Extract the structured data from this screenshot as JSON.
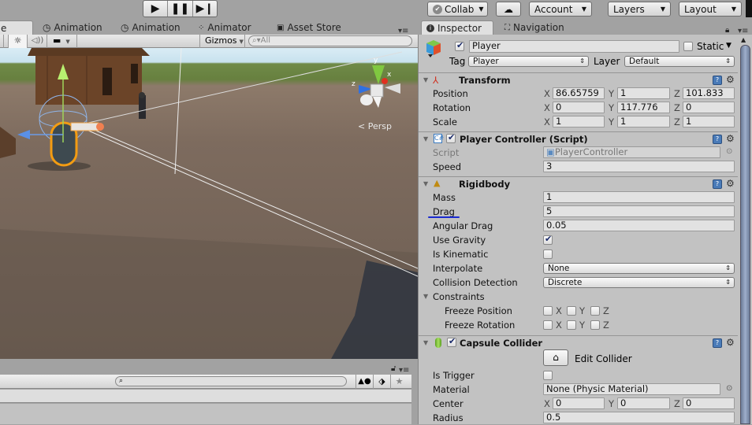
{
  "toolbar": {
    "play_icon": "play-icon",
    "pause_icon": "pause-icon",
    "step_icon": "step-icon",
    "collab": "Collab",
    "cloud_icon": "cloud-icon",
    "account": "Account",
    "layers": "Layers",
    "layout": "Layout"
  },
  "tabs": [
    {
      "label": "e",
      "icon": "scene-icon"
    },
    {
      "label": "Animation",
      "icon": "clock-icon"
    },
    {
      "label": "Animation",
      "icon": "clock-icon"
    },
    {
      "label": "Animator",
      "icon": "animator-icon"
    },
    {
      "label": "Asset Store",
      "icon": "store-icon"
    }
  ],
  "scene_toolbar": {
    "gizmos": "Gizmos",
    "search_placeholder": "All"
  },
  "scene": {
    "persp_label": "< Persp",
    "axis_y": "y",
    "axis_x": "x",
    "axis_z": "z"
  },
  "inspector": {
    "tabs": [
      {
        "label": "Inspector"
      },
      {
        "label": "Navigation"
      }
    ],
    "object": {
      "name": "Player",
      "active": true,
      "static_label": "Static",
      "static": false,
      "tag_label": "Tag",
      "tag": "Player",
      "layer_label": "Layer",
      "layer": "Default"
    },
    "transform": {
      "title": "Transform",
      "rows": [
        {
          "label": "Position",
          "x": "86.65759",
          "y": "1",
          "z": "101.833"
        },
        {
          "label": "Rotation",
          "x": "0",
          "y": "117.776",
          "z": "0"
        },
        {
          "label": "Scale",
          "x": "1",
          "y": "1",
          "z": "1"
        }
      ]
    },
    "player_controller": {
      "title": "Player Controller (Script)",
      "enabled": true,
      "script_label": "Script",
      "script_value": "PlayerController",
      "speed_label": "Speed",
      "speed_value": "3"
    },
    "rigidbody": {
      "title": "Rigidbody",
      "mass_label": "Mass",
      "mass": "1",
      "drag_label": "Drag",
      "drag": "5",
      "angular_drag_label": "Angular Drag",
      "angular_drag": "0.05",
      "use_gravity_label": "Use Gravity",
      "use_gravity": true,
      "is_kinematic_label": "Is Kinematic",
      "is_kinematic": false,
      "interpolate_label": "Interpolate",
      "interpolate": "None",
      "collision_label": "Collision Detection",
      "collision": "Discrete",
      "constraints_label": "Constraints",
      "freeze_position_label": "Freeze Position",
      "freeze_rotation_label": "Freeze Rotation",
      "axes": [
        "X",
        "Y",
        "Z"
      ]
    },
    "capsule_collider": {
      "title": "Capsule Collider",
      "enabled": true,
      "edit_collider": "Edit Collider",
      "is_trigger_label": "Is Trigger",
      "is_trigger": false,
      "material_label": "Material",
      "material": "None (Physic Material)",
      "center_label": "Center",
      "center_x": "0",
      "center_y": "0",
      "center_z": "0",
      "radius_label": "Radius",
      "radius": "0.5"
    }
  },
  "axis_labels": {
    "x": "X",
    "y": "Y",
    "z": "Z"
  }
}
